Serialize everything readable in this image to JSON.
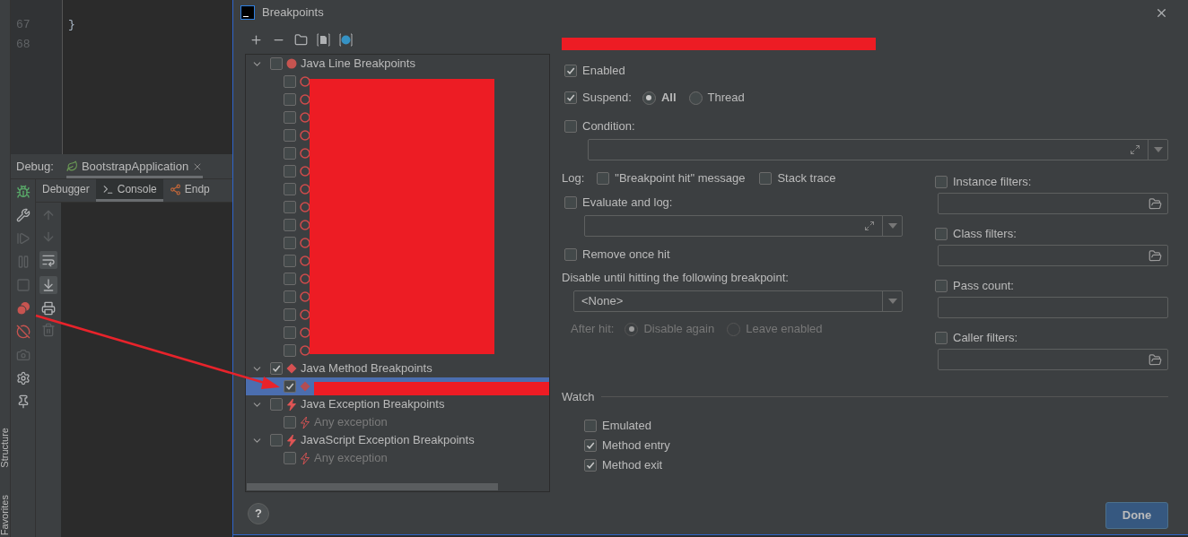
{
  "side_tool_windows": [
    "Structure",
    "Favorites"
  ],
  "editor": {
    "lines": [
      {
        "number": "67",
        "code": "}"
      },
      {
        "number": "68"
      }
    ]
  },
  "debug_panel": {
    "label": "Debug:",
    "session_tab": "BootstrapApplication",
    "tabs": [
      {
        "label": "Debugger",
        "selected": false,
        "kind": "plain"
      },
      {
        "label": "Console",
        "selected": true,
        "kind": "console"
      },
      {
        "label": "Endp",
        "selected": false,
        "kind": "endpoints"
      }
    ]
  },
  "dialog": {
    "title": "Breakpoints",
    "tree": [
      {
        "label": "Java Line Breakpoints",
        "kind": "line",
        "checked": false,
        "expanded": true,
        "children": [
          {
            "checked": false,
            "selected": false
          },
          {
            "checked": false,
            "selected": false
          },
          {
            "checked": false,
            "selected": false
          },
          {
            "checked": false,
            "selected": false
          },
          {
            "checked": false,
            "selected": false
          },
          {
            "checked": false,
            "selected": false
          },
          {
            "checked": false,
            "selected": false
          },
          {
            "checked": false,
            "selected": false
          },
          {
            "checked": false,
            "selected": false
          },
          {
            "checked": false,
            "selected": false
          },
          {
            "checked": false,
            "selected": false
          },
          {
            "checked": false,
            "selected": false
          },
          {
            "checked": false,
            "selected": false
          },
          {
            "checked": false,
            "selected": false
          },
          {
            "checked": false,
            "selected": false
          },
          {
            "checked": false,
            "selected": false
          }
        ]
      },
      {
        "label": "Java Method Breakpoints",
        "kind": "method",
        "checked": true,
        "expanded": true,
        "children": [
          {
            "checked": true,
            "selected": true
          }
        ]
      },
      {
        "label": "Java Exception Breakpoints",
        "kind": "exception",
        "checked": false,
        "expanded": true,
        "children": [
          {
            "label": "Any exception",
            "checked": false,
            "selected": false
          }
        ]
      },
      {
        "label": "JavaScript Exception Breakpoints",
        "kind": "exception",
        "checked": false,
        "expanded": true,
        "children": [
          {
            "label": "Any exception",
            "checked": false,
            "selected": false
          }
        ]
      }
    ],
    "enabled": {
      "label": "Enabled",
      "checked": true
    },
    "suspend": {
      "label": "Suspend:",
      "checked": true,
      "options": [
        {
          "label": "All",
          "selected": true
        },
        {
          "label": "Thread",
          "selected": false
        }
      ]
    },
    "condition": {
      "label": "Condition:",
      "checked": false
    },
    "log": {
      "label": "Log:",
      "options": [
        {
          "label": "\"Breakpoint hit\" message",
          "checked": false
        },
        {
          "label": "Stack trace",
          "checked": false
        }
      ]
    },
    "evaluate_and_log": {
      "label": "Evaluate and log:",
      "checked": false
    },
    "remove_once_hit": {
      "label": "Remove once hit",
      "checked": false
    },
    "disable_until": {
      "label": "Disable until hitting the following breakpoint:",
      "value": "<None>",
      "after_hit": {
        "label": "After hit:",
        "disabled": true,
        "options": [
          {
            "label": "Disable again",
            "selected": true
          },
          {
            "label": "Leave enabled",
            "selected": false
          }
        ]
      }
    },
    "filters": [
      {
        "label": "Instance filters:",
        "checked": false,
        "browse": true
      },
      {
        "label": "Class filters:",
        "checked": false,
        "browse": true
      },
      {
        "label": "Pass count:",
        "checked": false,
        "browse": false
      },
      {
        "label": "Caller filters:",
        "checked": false,
        "browse": true
      }
    ],
    "watch": {
      "label": "Watch",
      "options": [
        {
          "label": "Emulated",
          "checked": false
        },
        {
          "label": "Method entry",
          "checked": true
        },
        {
          "label": "Method exit",
          "checked": true
        }
      ]
    },
    "done_button": "Done",
    "help_button": "?"
  }
}
